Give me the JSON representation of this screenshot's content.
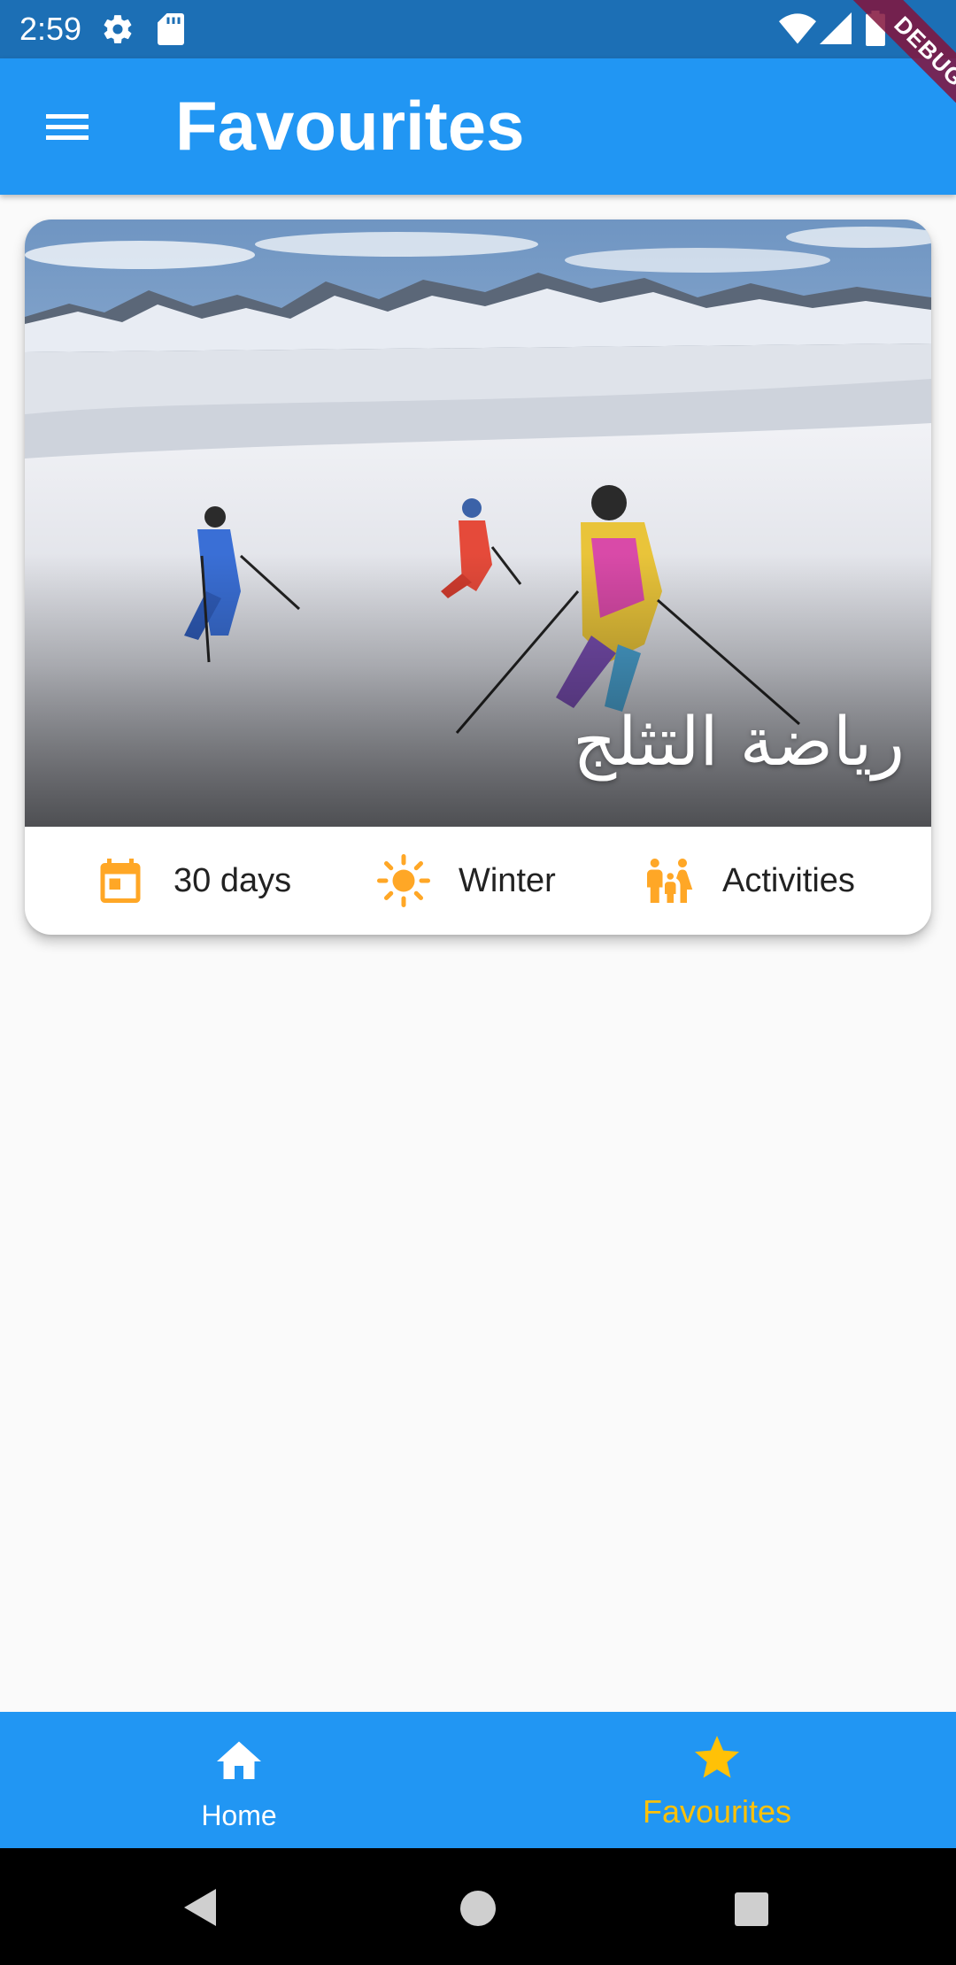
{
  "status_bar": {
    "time": "2:59",
    "icons": [
      "settings-gear-icon",
      "sd-card-icon",
      "wifi-icon",
      "cellular-signal-icon",
      "battery-icon"
    ],
    "background_color": "#1c6fb5"
  },
  "debug_banner": {
    "label": "DEBUG"
  },
  "app_bar": {
    "title": "Favourites",
    "menu_icon": "hamburger-menu-icon",
    "background_color": "#2196f3"
  },
  "favourites": [
    {
      "title": "رياضة التثلج",
      "image": "skiers-on-snowy-mountain-slope",
      "duration": {
        "icon": "calendar-icon",
        "label": "30 days"
      },
      "season": {
        "icon": "sun-icon",
        "label": "Winter"
      },
      "type": {
        "icon": "family-icon",
        "label": "Activities"
      }
    }
  ],
  "bottom_nav": {
    "items": [
      {
        "label": "Home",
        "icon": "home-icon",
        "selected": false
      },
      {
        "label": "Favourites",
        "icon": "star-icon",
        "selected": true
      }
    ],
    "accent_color": "#ffc107"
  },
  "system_nav": {
    "buttons": [
      "back-triangle-icon",
      "home-circle-icon",
      "recents-square-icon"
    ]
  }
}
